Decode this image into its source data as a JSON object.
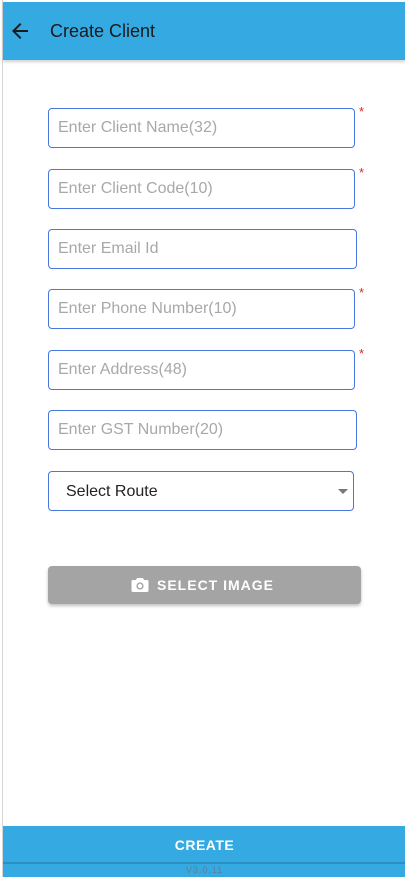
{
  "app_bar": {
    "title": "Create Client",
    "back_icon": "arrow-left-icon",
    "color": "#34a9e2"
  },
  "form": {
    "fields": [
      {
        "placeholder": "Enter Client Name(32)",
        "value": "",
        "required": true
      },
      {
        "placeholder": "Enter Client Code(10)",
        "value": "",
        "required": true
      },
      {
        "placeholder": "Enter Email Id",
        "value": "",
        "required": false
      },
      {
        "placeholder": "Enter Phone Number(10)",
        "value": "",
        "required": true
      },
      {
        "placeholder": "Enter Address(48)",
        "value": "",
        "required": true
      },
      {
        "placeholder": "Enter GST Number(20)",
        "value": "",
        "required": false
      }
    ],
    "required_marker": "*",
    "route_select": {
      "selected": "Select Route",
      "icon": "chevron-down-icon"
    },
    "select_image_button": {
      "label": "SELECT IMAGE",
      "icon": "camera-icon"
    }
  },
  "footer": {
    "create_label": "CREATE",
    "version": "V3.0.11"
  }
}
